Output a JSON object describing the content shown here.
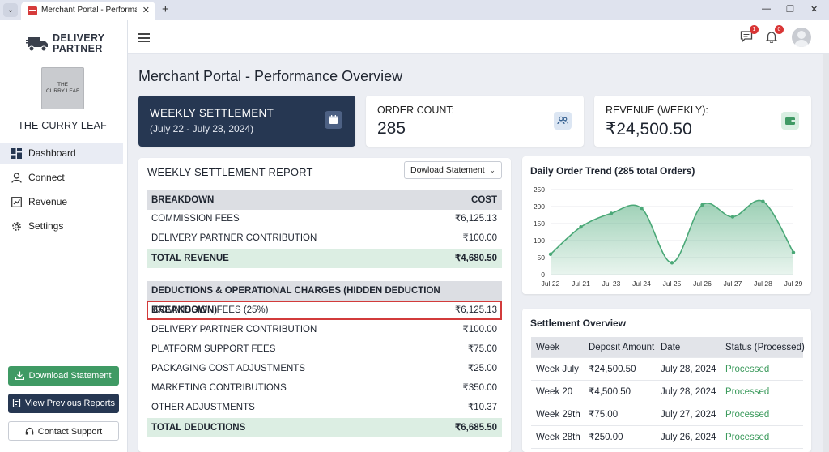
{
  "browser": {
    "tab_title": "Merchant Portal - Performance",
    "menu_glyph": "⌄",
    "close_glyph": "✕",
    "new_tab_glyph": "+",
    "minimize_glyph": "—",
    "maximize_glyph": "❐",
    "window_close_glyph": "✕"
  },
  "brand": {
    "line1": "DELIVERY",
    "line2": "PARTNER",
    "logo_line1": "THE",
    "logo_line2": "CURRY LEAF",
    "restaurant_name": "THE CURRY LEAF"
  },
  "sidebar": {
    "items": [
      {
        "label": "Dashboard",
        "icon": "dashboard-icon",
        "active": true
      },
      {
        "label": "Connect",
        "icon": "user-icon",
        "active": false
      },
      {
        "label": "Revenue",
        "icon": "chart-icon",
        "active": false
      },
      {
        "label": "Settings",
        "icon": "gear-icon",
        "active": false
      }
    ],
    "download_label": "Download Statement",
    "previous_label": "View Previous Reports",
    "support_label": "Contact Support"
  },
  "topbar": {
    "messages_badge": "1",
    "notifications_badge": "0"
  },
  "page": {
    "title": "Merchant Portal - Performance Overview"
  },
  "kpis": {
    "settlement_title": "WEEKLY SETTLEMENT",
    "settlement_range": "(July 22 - July 28, 2024)",
    "order_label": "ORDER COUNT:",
    "order_value": "285",
    "revenue_label": "REVENUE (WEEKLY):",
    "revenue_value": "₹24,500.50"
  },
  "report": {
    "title": "WEEKLY SETTLEMENT REPORT",
    "download_select": "Dowload Statement",
    "breakdown_header": "BREAKDOWN",
    "cost_header": "COST",
    "revenue_rows": [
      {
        "label": "COMMISSION FEES",
        "cost": "₹6,125.13"
      },
      {
        "label": "DELIVERY PARTNER CONTRIBUTION",
        "cost": "₹100.00"
      }
    ],
    "total_revenue_label": "TOTAL REVENUE",
    "total_revenue_value": "₹4,680.50",
    "deductions_header": "DEDUCTIONS & OPERATIONAL CHARGES (HIDDEN DEDUCTION BREAKDOWN)",
    "deduction_rows": [
      {
        "label": "COMMISSION FEES (25%)",
        "cost": "₹6,125.13",
        "highlighted": true
      },
      {
        "label": "DELIVERY PARTNER CONTRIBUTION",
        "cost": "₹100.00"
      },
      {
        "label": "PLATFORM SUPPORT FEES",
        "cost": "₹75.00"
      },
      {
        "label": "PACKAGING COST ADJUSTMENTS",
        "cost": "₹25.00"
      },
      {
        "label": "MARKETING CONTRIBUTIONS",
        "cost": "₹350.00"
      },
      {
        "label": "OTHER ADJUSTMENTS",
        "cost": "₹10.37"
      }
    ],
    "total_deductions_label": "TOTAL DEDUCTIONS",
    "total_deductions_value": "₹6,685.50"
  },
  "chart_data": {
    "type": "area",
    "title": "Daily Order Trend (285 total Orders)",
    "xlabel": "",
    "ylabel": "",
    "categories": [
      "Jul 22",
      "Jul 21",
      "Jul 23",
      "Jul 24",
      "Jul 25",
      "Jul 26",
      "Jul 27",
      "Jul 28",
      "Jul 29"
    ],
    "values": [
      60,
      140,
      180,
      195,
      35,
      205,
      170,
      215,
      65
    ],
    "ylim": [
      0,
      250
    ],
    "yticks": [
      0,
      50,
      100,
      150,
      200,
      250
    ],
    "color": "#4aa877",
    "grid": true
  },
  "settlement_overview": {
    "title": "Settlement Overview",
    "columns": [
      "Week",
      "Deposit Amount",
      "Date",
      "Status (Processed)"
    ],
    "rows": [
      {
        "week": "Week July",
        "amount": "₹24,500.50",
        "date": "July 28, 2024",
        "status": "Processed"
      },
      {
        "week": "Week 20",
        "amount": "₹4,500.50",
        "date": "July 28, 2024",
        "status": "Processed"
      },
      {
        "week": "Week 29th",
        "amount": "₹75.00",
        "date": "July 27, 2024",
        "status": "Processed"
      },
      {
        "week": "Week 28th",
        "amount": "₹250.00",
        "date": "July 26, 2024",
        "status": "Processed"
      }
    ]
  }
}
